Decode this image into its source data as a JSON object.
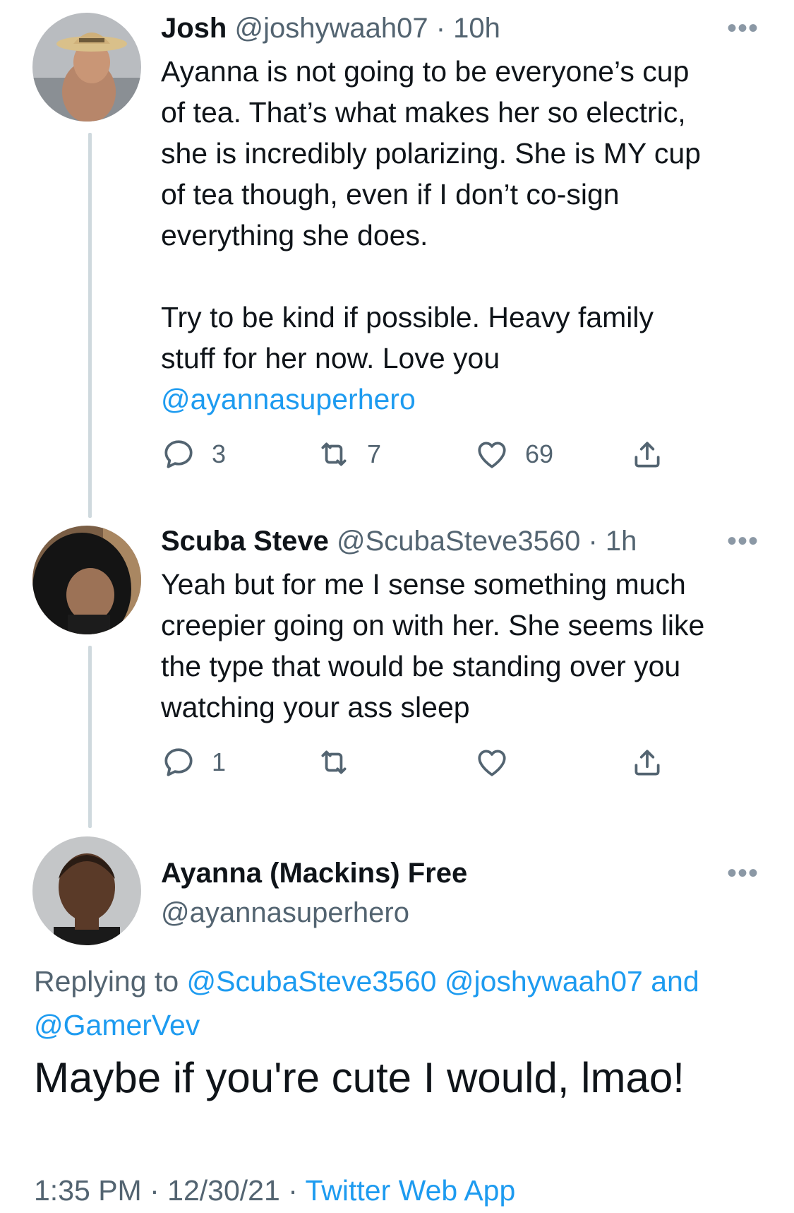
{
  "tweets": [
    {
      "name": "Josh",
      "handle": "@joshywaah07",
      "separator": "·",
      "time": "10h",
      "text_lines": [
        "Ayanna is not going to be everyone’s cup",
        "of tea. That’s what makes her so electric,",
        "she is incredibly polarizing. She is MY cup",
        "of tea though, even if I don’t co-sign",
        "everything she does."
      ],
      "text_lines_2": [
        "Try to be kind if possible. Heavy family",
        "stuff for her now. Love you"
      ],
      "mention": "@ayannasuperhero",
      "reply_count": "3",
      "retweet_count": "7",
      "like_count": "69",
      "more_label": "•••",
      "avatar_icon": "avatar-cowboy-hat"
    },
    {
      "name": "Scuba Steve",
      "handle": "@ScubaSteve3560",
      "separator": "·",
      "time": "1h",
      "text_lines": [
        "Yeah but for me I sense something much",
        "creepier going on with her. She seems like",
        "the type that would be standing over you",
        "watching your ass sleep"
      ],
      "reply_count": "1",
      "more_label": "•••",
      "avatar_icon": "avatar-hood"
    }
  ],
  "main_tweet": {
    "name": "Ayanna (Mackins) Free",
    "handle": "@ayannasuperhero",
    "more_label": "•••",
    "replying_prefix": "Replying to",
    "reply_mention_1": "@ScubaSteve3560",
    "reply_mention_2": "@joshywaah07",
    "reply_and": "and",
    "reply_mention_3": "@GamerVev",
    "text": "Maybe if you're cute I would, lmao!",
    "time": "1:35 PM",
    "date": "12/30/21",
    "separator": "·",
    "source": "Twitter Web App"
  },
  "colors": {
    "link": "#1d9bf0",
    "secondary": "#536471",
    "thread_line": "#cfd9de"
  }
}
